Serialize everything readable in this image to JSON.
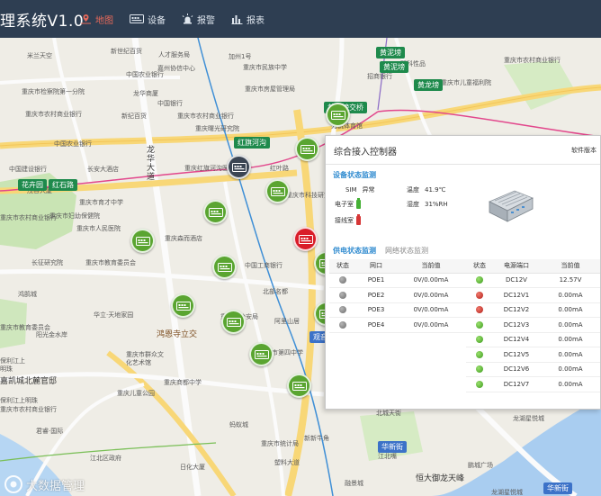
{
  "header": {
    "title": "理系统V1.0",
    "nav": [
      {
        "label": "地图",
        "icon": "map-icon",
        "active": true
      },
      {
        "label": "设备",
        "icon": "device-icon",
        "active": false
      },
      {
        "label": "报警",
        "icon": "alarm-icon",
        "active": false
      },
      {
        "label": "报表",
        "icon": "report-icon",
        "active": false
      }
    ]
  },
  "map": {
    "labels": [
      "米兰天空",
      "新世纪百货",
      "人才服务局",
      "加州1号",
      "重庆市民族中学",
      "中国农业银行",
      "嘉州协信中心",
      "双科性品",
      "重庆市农村商业银行",
      "重庆市检察院第一分院",
      "龙华商厦",
      "中国银行",
      "重庆市房屋管理局",
      "重庆市农村商业银行",
      "新纪百货",
      "中国农业银行",
      "中国建设银行",
      "长安大酒店",
      "重庆市农村商业银行",
      "招商银行",
      "龙华大道",
      "重庆红旗河沟医院",
      "重庆曙光研究院",
      "力帆体育馆",
      "重庆市儿童福利院",
      "茂谷大厦",
      "重庆市育才中学",
      "重庆市妇幼保健院",
      "重庆市农村商业银行",
      "重庆市人民医院",
      "红叶路",
      "重庆市科技研究所",
      "长征研究院",
      "重庆市教育委员会",
      "重庆森而酒店",
      "中国工商银行",
      "北部名都",
      "鸿鹄城",
      "阳光金水岸",
      "华立·天地家园",
      "重庆市教育委员会",
      "保利江上明珠",
      "重庆市公安局",
      "阿里山居",
      "重庆市群众文化艺术馆",
      "重庆商都中学",
      "重庆儿童公园",
      "重庆市第四中学",
      "保利江上明珠",
      "蚂蚁城",
      "嘉凯城北麓官邸",
      "重庆市农村商业银行",
      "君睿·国际",
      "江北区政府",
      "日化大厦",
      "重庆市统计局",
      "新新牛角",
      "龙湖星悦城",
      "塑料大道",
      "江北嘴",
      "鹏城广场",
      "恒大御龙天峰",
      "融景城",
      "龙湖星悦城",
      "北城天街"
    ],
    "badges": [
      {
        "text": "黄泥塝",
        "color": "green"
      },
      {
        "text": "黄龙塝",
        "color": "green"
      },
      {
        "text": "黄泥塝",
        "color": "green"
      },
      {
        "text": "红旗河沟",
        "color": "green"
      },
      {
        "text": "花卉园",
        "color": "green"
      },
      {
        "text": "红石路",
        "color": "green"
      },
      {
        "text": "观音岩",
        "color": "blue"
      },
      {
        "text": "华新街",
        "color": "blue"
      },
      {
        "text": "华新街",
        "color": "blue"
      },
      {
        "text": "黄泥塝交桥",
        "color": "green"
      }
    ],
    "district": "鸿恩寺立交",
    "watermark": "大数据管理",
    "markers": [
      {
        "status": "green"
      },
      {
        "status": "green"
      },
      {
        "status": "green"
      },
      {
        "status": "dark"
      },
      {
        "status": "green"
      },
      {
        "status": "green"
      },
      {
        "status": "green"
      },
      {
        "status": "green"
      },
      {
        "status": "red"
      },
      {
        "status": "green"
      },
      {
        "status": "green"
      },
      {
        "status": "green"
      },
      {
        "status": "green"
      },
      {
        "status": "green"
      }
    ]
  },
  "panel": {
    "title": "综合接入控制器",
    "version": "软件版本",
    "device_section": "设备状态监测",
    "sim_label": "SIM",
    "sim_value": "异常",
    "temp_label": "温度",
    "temp_value": "41.9℃",
    "humidity_label": "湿度",
    "humidity_value": "31%RH",
    "door1_label": "电子室",
    "door2_label": "接线室",
    "tabs": [
      {
        "label": "供电状态监测",
        "active": true
      },
      {
        "label": "网络状态监测",
        "active": false
      }
    ],
    "poe_table": {
      "headers": [
        "状态",
        "网口",
        "当前值"
      ],
      "rows": [
        {
          "status": "gray",
          "port": "POE1",
          "value": "0V/0.00mA"
        },
        {
          "status": "gray",
          "port": "POE2",
          "value": "0V/0.00mA"
        },
        {
          "status": "gray",
          "port": "POE3",
          "value": "0V/0.00mA"
        },
        {
          "status": "gray",
          "port": "POE4",
          "value": "0V/0.00mA"
        }
      ]
    },
    "power_table": {
      "headers": [
        "状态",
        "电源端口",
        "当前值"
      ],
      "rows": [
        {
          "status": "green",
          "port": "DC12V",
          "value": "12.57V"
        },
        {
          "status": "red",
          "port": "DC12V1",
          "value": "0.00mA"
        },
        {
          "status": "red",
          "port": "DC12V2",
          "value": "0.00mA"
        },
        {
          "status": "green",
          "port": "DC12V3",
          "value": "0.00mA"
        },
        {
          "status": "green",
          "port": "DC12V4",
          "value": "0.00mA"
        },
        {
          "status": "green",
          "port": "DC12V5",
          "value": "0.00mA"
        },
        {
          "status": "green",
          "port": "DC12V6",
          "value": "0.00mA"
        },
        {
          "status": "green",
          "port": "DC12V7",
          "value": "0.00mA"
        }
      ]
    }
  }
}
